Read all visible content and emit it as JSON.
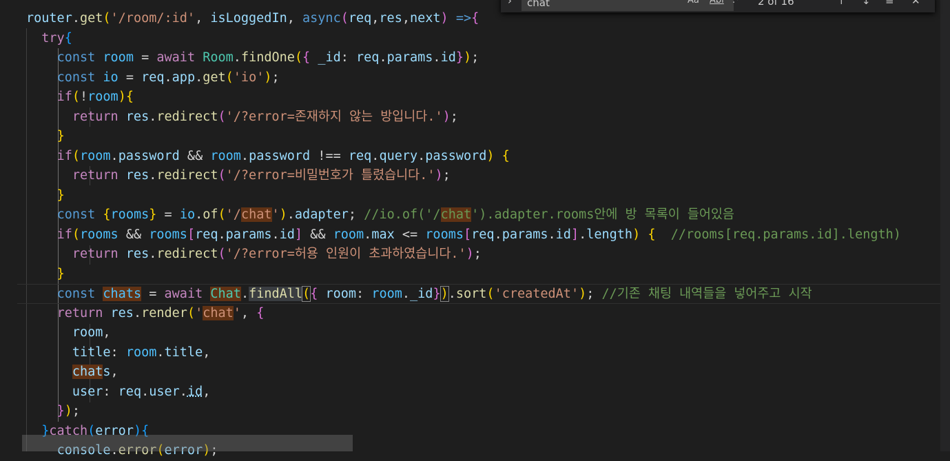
{
  "find": {
    "query": "chat",
    "count": "2 of 16",
    "match_case_label": "Aa",
    "whole_word_label": "Abl",
    "regex_label": ".*"
  },
  "code_lines": [
    "router.get('/room/:id', isLoggedIn, async(req,res,next) =>{",
    "  try{",
    "    const room = await Room.findOne({ _id: req.params.id});",
    "    const io = req.app.get('io');",
    "    if(!room){",
    "      return res.redirect('/?error=존재하지 않는 방입니다.');",
    "    }",
    "    if(room.password && room.password !== req.query.password) {",
    "      return res.redirect('/?error=비밀번호가 틀렸습니다.');",
    "    }",
    "    const {rooms} = io.of('/chat').adapter; //io.of('/chat').adapter.rooms안에 방 목록이 들어있음",
    "    if(rooms && rooms[req.params.id] && room.max <= rooms[req.params.id].length) {  //rooms[req.params.id].length)",
    "      return res.redirect('/?error=허용 인원이 초과하였습니다.');",
    "    }",
    "    const chats = await Chat.findAll({ room: room._id}).sort('createdAt'); //기존 채팅 내역들을 넣어주고 시작",
    "    return res.render('chat', {",
    "      room,",
    "      title: room.title,",
    "      chats,",
    "      user: req.user.id,",
    "    });",
    "  }catch(error){",
    "    console.error(error);"
  ]
}
